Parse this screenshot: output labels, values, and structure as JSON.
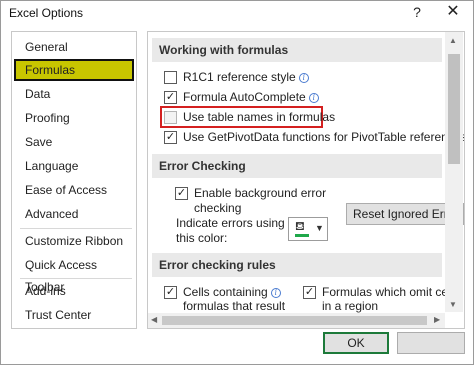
{
  "window": {
    "title": "Excel Options",
    "help_glyph": "?",
    "close_glyph": "✕"
  },
  "sidebar": {
    "items": [
      {
        "label": "General"
      },
      {
        "label": "Formulas",
        "active": true
      },
      {
        "label": "Data"
      },
      {
        "label": "Proofing"
      },
      {
        "label": "Save"
      },
      {
        "label": "Language"
      },
      {
        "label": "Ease of Access"
      },
      {
        "label": "Advanced"
      },
      {
        "label": "Customize Ribbon"
      },
      {
        "label": "Quick Access Toolbar"
      },
      {
        "label": "Add-ins"
      },
      {
        "label": "Trust Center"
      }
    ]
  },
  "sections": {
    "working_with_formulas": {
      "title": "Working with formulas",
      "options": [
        {
          "label": "R1C1 reference style",
          "checked": false,
          "info": true
        },
        {
          "label": "Formula AutoComplete",
          "checked": true,
          "info": true
        },
        {
          "label": "Use table names in formulas",
          "checked": false,
          "highlighted": true
        },
        {
          "label": "Use GetPivotData functions for PivotTable references",
          "checked": true
        }
      ]
    },
    "error_checking": {
      "title": "Error Checking",
      "enable_label_1": "Enable background error",
      "enable_label_2": "checking",
      "enable_checked": true,
      "indicate_label_1": "Indicate errors using",
      "indicate_label_2": "this color:",
      "indicator_color": "#1fa84a",
      "reset_button": "Reset Ignored Errors"
    },
    "error_checking_rules": {
      "title": "Error checking rules",
      "rules": [
        {
          "line1": "Cells containing",
          "line2": "formulas that result",
          "checked": true,
          "info": true
        },
        {
          "line1": "Formulas which omit cells",
          "line2": "in a region",
          "checked": true
        }
      ]
    }
  },
  "footer": {
    "ok_label": "OK",
    "cancel_label": ""
  },
  "colors": {
    "active_sidebar": "#c8c600",
    "highlight_border": "#d42020",
    "ok_border": "#1d7a3a"
  }
}
